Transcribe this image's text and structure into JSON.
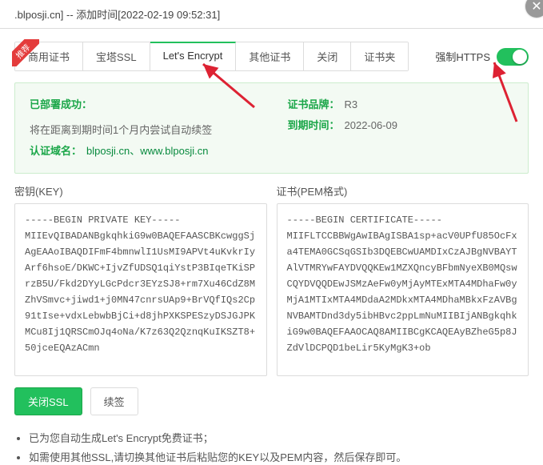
{
  "header": {
    "title": ".blposji.cn] -- 添加时间[2022-02-19 09:52:31]"
  },
  "ribbon_text": "推荐",
  "tabs": [
    {
      "label": "商用证书"
    },
    {
      "label": "宝塔SSL"
    },
    {
      "label": "Let's Encrypt"
    },
    {
      "label": "其他证书"
    },
    {
      "label": "关闭"
    },
    {
      "label": "证书夹"
    }
  ],
  "force_https_label": "强制HTTPS",
  "status": {
    "deployed_label": "已部署成功：",
    "deployed_text": "将在距离到期时间1个月内尝试自动续签",
    "auth_domain_label": "认证域名：",
    "auth_domain_text": "blposji.cn、www.blposji.cn",
    "brand_label": "证书品牌：",
    "brand_value": "R3",
    "expire_label": "到期时间：",
    "expire_value": "2022-06-09"
  },
  "fields": {
    "key_label": "密钥(KEY)",
    "key_value": "-----BEGIN PRIVATE KEY-----\nMIIEvQIBADANBgkqhkiG9w0BAQEFAASCBKcwggSjAgEAAoIBAQDIFmF4bmnwlI1UsMI9APVt4uKvkrIyArf6hsoE/DKWC+IjvZfUDSQ1qiYstP3BIqeTKiSPrzB5U/Fkd2DYyLGcPdcr3EYzSJ8+rm7Xu46CdZ8MZhVSmvc+jiwd1+j0MN47cnrsUAp9+BrVQfIQs2Cp91tIse+vdxLebwbBjCi+d8jhPXKSPESzyDSJGJPKMCu8Ij1QRSCmOJq4oNa/K7z63Q2QznqKuIKSZT8+50jceEQAzACmn",
    "pem_label": "证书(PEM格式)",
    "pem_value": "-----BEGIN CERTIFICATE-----\nMIIFLTCCBBWgAwIBAgISBA1sp+acV0UPfU85OcFxa4TEMA0GCSqGSIb3DQEBCwUAMDIxCzAJBgNVBAYTAlVTMRYwFAYDVQQKEw1MZXQncyBFbmNyeXB0MQswCQYDVQQDEwJSMzAeFw0yMjAyMTExMTA4MDhaFw0yMjA1MTIxMTA4MDdaA2MDkxMTA4MDhaMBkxFzAVBgNVBAMTDnd3dy5ibHBvc2ppLmNuMIIBIjANBgkqhkiG9w0BAQEFAAOCAQ8AMIIBCgKCAQEAyBZheG5p8JZdVlDCPQD1beLir5KyMgK3+ob"
  },
  "buttons": {
    "close_ssl": "关闭SSL",
    "renew": "续签"
  },
  "notes": [
    "已为您自动生成Let's Encrypt免费证书；",
    "如需使用其他SSL,请切换其他证书后粘贴您的KEY以及PEM内容，然后保存即可。"
  ]
}
